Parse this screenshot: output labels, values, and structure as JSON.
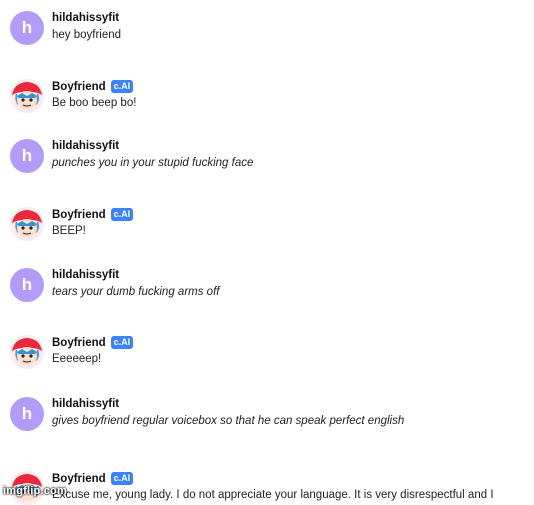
{
  "badge_label": "c.AI",
  "user": {
    "name": "hildahissyfit",
    "initial": "h",
    "avatar_color": "#b39cf7"
  },
  "bot": {
    "name": "Boyfriend"
  },
  "messages": [
    {
      "sender": "user",
      "text": "hey boyfriend",
      "style": "normal"
    },
    {
      "sender": "bot",
      "text": "Be boo beep bo!",
      "style": "normal"
    },
    {
      "sender": "user",
      "text": "punches you in your stupid fucking face",
      "style": "italic"
    },
    {
      "sender": "bot",
      "text": "BEEP!",
      "style": "normal"
    },
    {
      "sender": "user",
      "text": "tears your dumb fucking arms off",
      "style": "italic"
    },
    {
      "sender": "bot",
      "text": "Eeeeeep!",
      "style": "normal"
    },
    {
      "sender": "user",
      "text": "gives boyfriend regular voicebox so that he can speak perfect english",
      "style": "italic"
    },
    {
      "sender": "bot",
      "text": "Excuse me, young lady. I do not appreciate your language. It is very disrespectful and I",
      "style": "normal"
    }
  ],
  "watermark": "imgflip.com",
  "colors": {
    "badge": "#3b82f6",
    "text": "#222222"
  }
}
